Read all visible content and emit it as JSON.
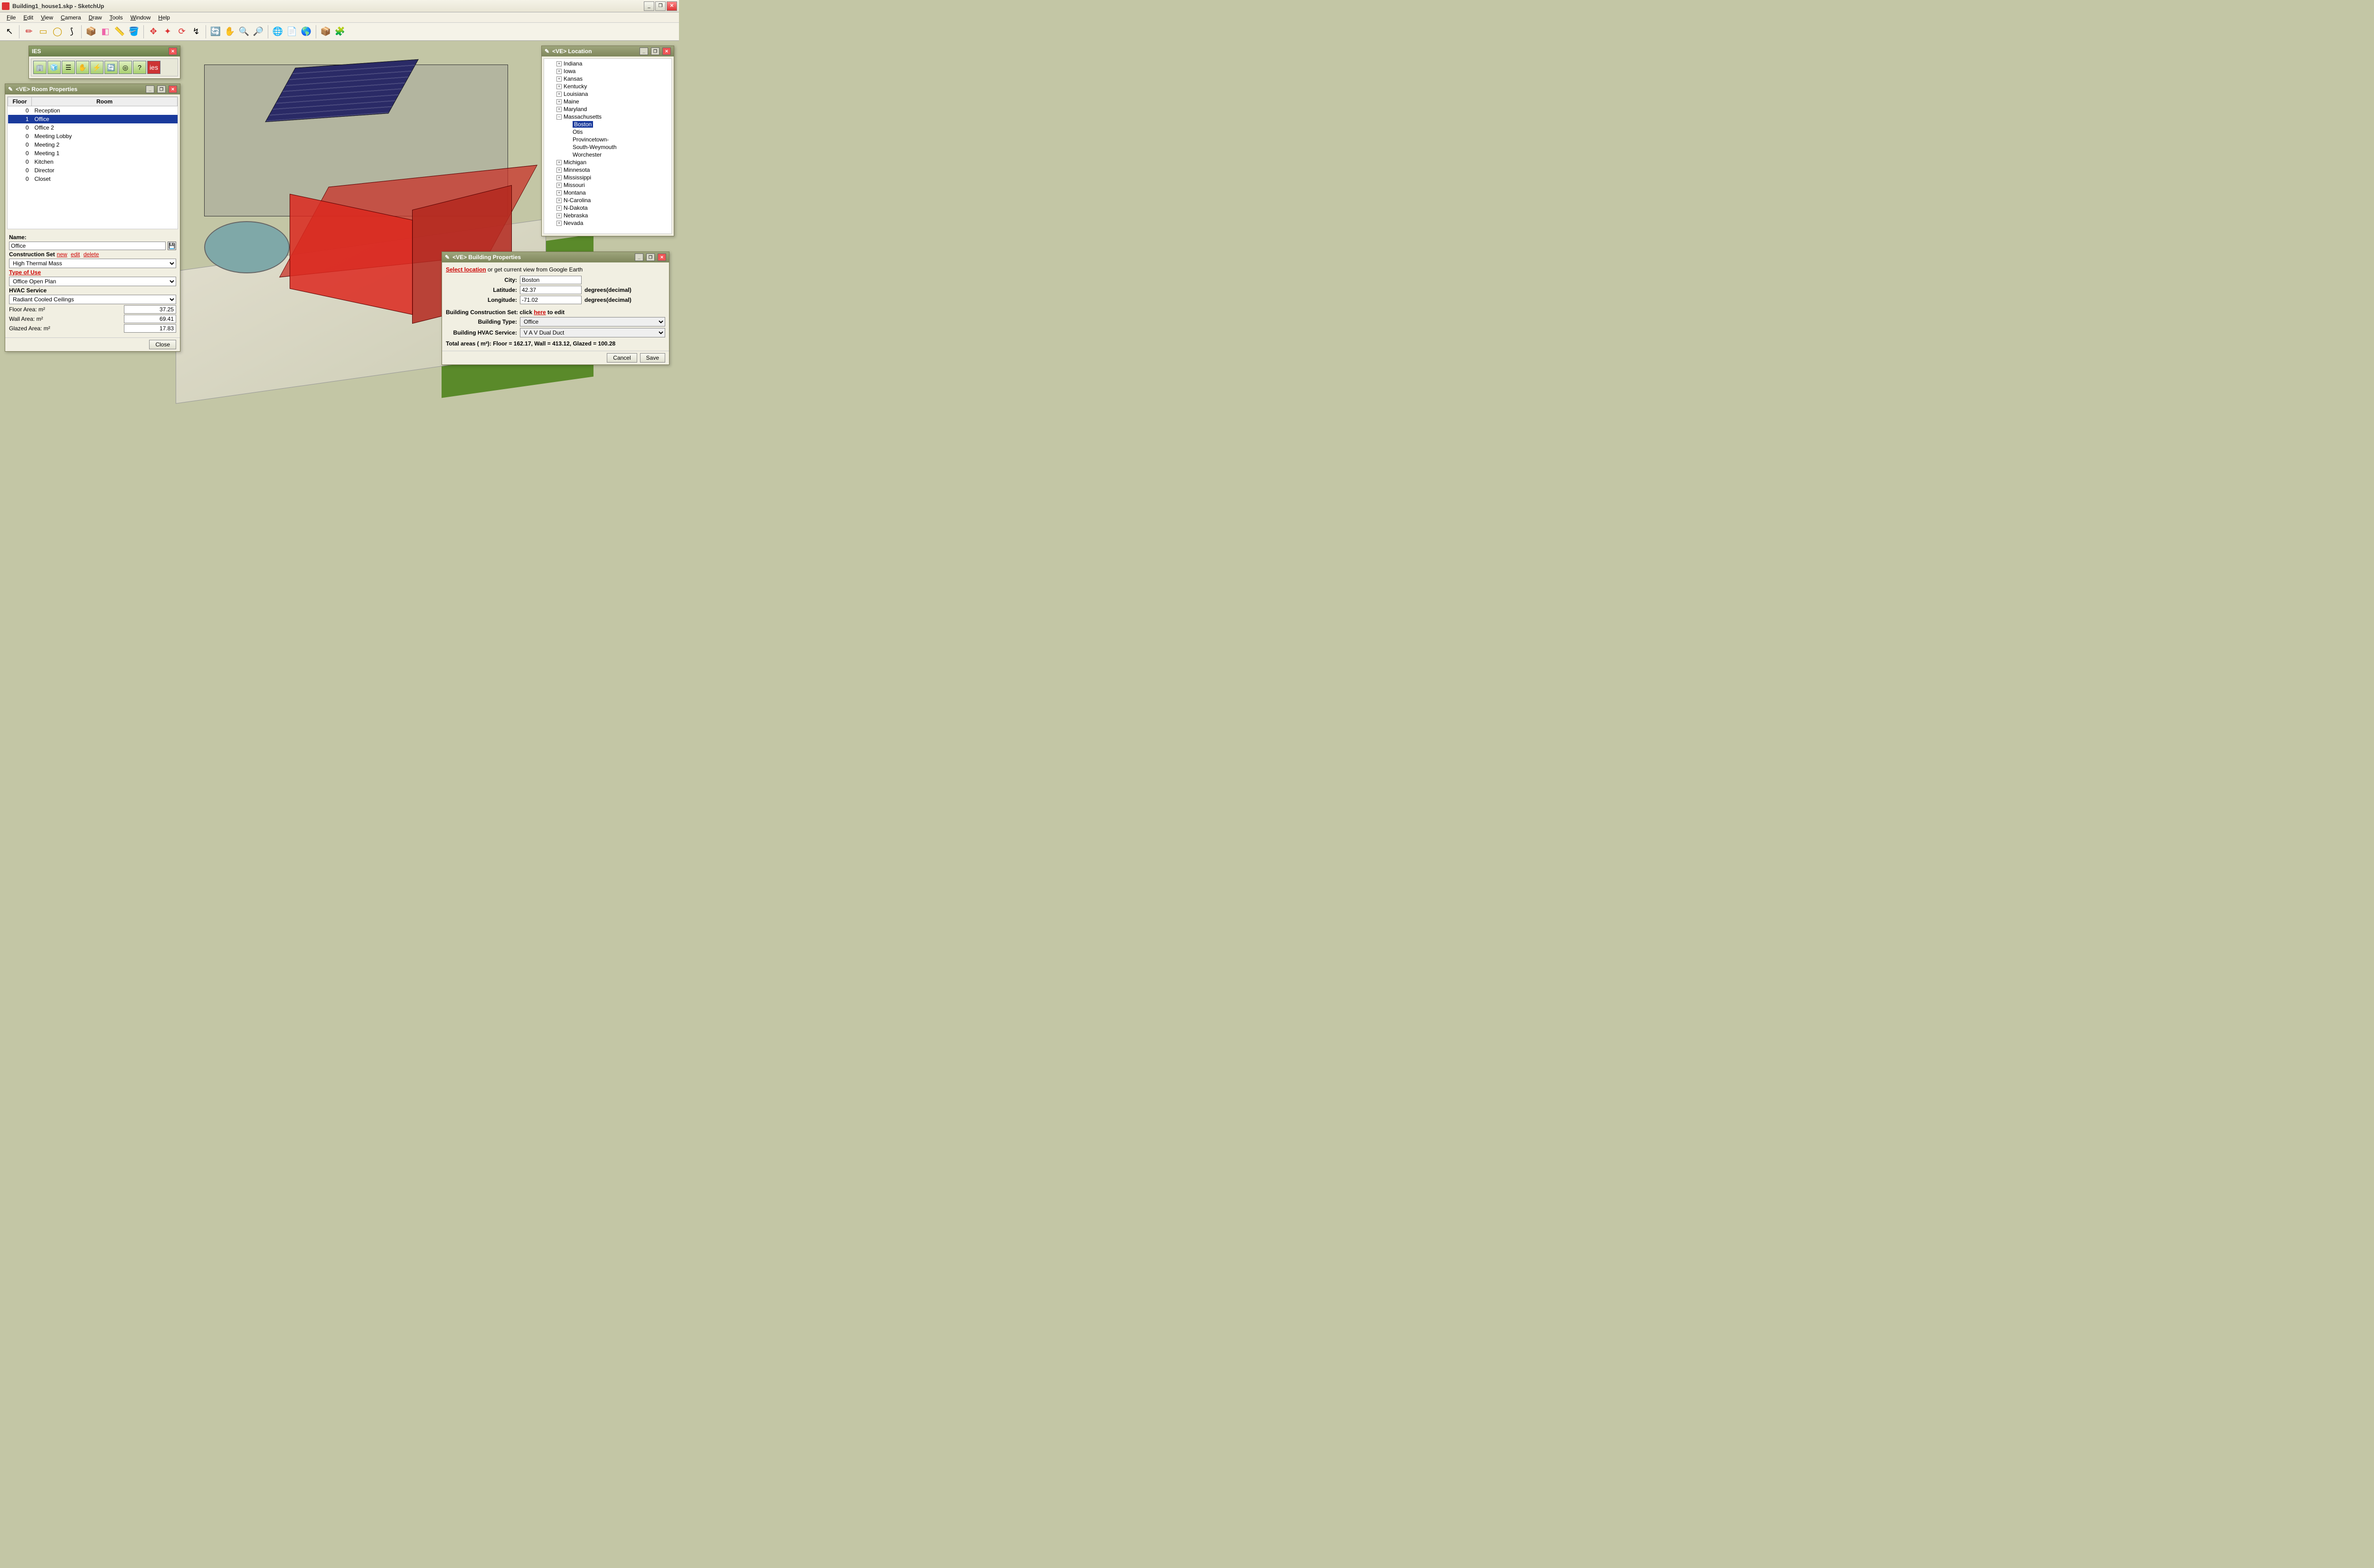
{
  "window": {
    "title": "Building1_house1.skp - SketchUp"
  },
  "menu": [
    "File",
    "Edit",
    "View",
    "Camera",
    "Draw",
    "Tools",
    "Window",
    "Help"
  ],
  "ies_panel": {
    "title": "IES"
  },
  "room_panel": {
    "title": "<VE> Room Properties",
    "cols": [
      "Floor",
      "Room"
    ],
    "rows": [
      {
        "floor": "0",
        "room": "Reception"
      },
      {
        "floor": "1",
        "room": "Office",
        "selected": true
      },
      {
        "floor": "0",
        "room": "Office 2"
      },
      {
        "floor": "0",
        "room": "Meeting Lobby"
      },
      {
        "floor": "0",
        "room": "Meeting 2"
      },
      {
        "floor": "0",
        "room": "Meeting 1"
      },
      {
        "floor": "0",
        "room": "Kitchen"
      },
      {
        "floor": "0",
        "room": "Director"
      },
      {
        "floor": "0",
        "room": "Closet"
      }
    ],
    "name_label": "Name:",
    "name_value": "Office",
    "cons_label": "Construction Set",
    "cons_links": [
      "new",
      "edit",
      "delete"
    ],
    "cons_value": "High Thermal Mass",
    "type_label": "Type of Use",
    "type_value": "Office Open Plan",
    "hvac_label": "HVAC Service",
    "hvac_value": "Radiant Cooled Ceilings",
    "floor_area_label": "Floor Area: m²",
    "floor_area": "37.25",
    "wall_area_label": "Wall Area: m²",
    "wall_area": "69.41",
    "glazed_area_label": "Glazed Area: m²",
    "glazed_area": "17.83",
    "close_btn": "Close"
  },
  "location_panel": {
    "title": "<VE> Location",
    "states_before": [
      "Indiana",
      "Iowa",
      "Kansas",
      "Kentucky",
      "Louisiana",
      "Maine",
      "Maryland"
    ],
    "expanded_state": "Massachusetts",
    "cities": [
      "Boston",
      "Otis",
      "Provincetown-",
      "South-Weymouth",
      "Worchester"
    ],
    "selected_city": "Boston",
    "states_after": [
      "Michigan",
      "Minnesota",
      "Mississippi",
      "Missouri",
      "Montana",
      "N-Carolina",
      "N-Dakota",
      "Nebraska",
      "Nevada"
    ]
  },
  "building_panel": {
    "title": "<VE> Building Properties",
    "select_loc": "Select location",
    "or_text": " or get current view from Google Earth",
    "city_label": "City:",
    "city": "Boston",
    "lat_label": "Latitude:",
    "lat": "42.37",
    "lon_label": "Longitude:",
    "lon": "-71.02",
    "deg_unit": "degrees(decimal)",
    "cons_text_a": "Building Construction Set: click ",
    "cons_here": "here",
    "cons_text_b": " to edit",
    "btype_label": "Building Type:",
    "btype": "Office",
    "bhvac_label": "Building HVAC Service:",
    "bhvac": "V A V Dual Duct",
    "totals": "Total areas ( m²): Floor =  162.17, Wall =  413.12, Glazed =  100.28",
    "cancel": "Cancel",
    "save": "Save"
  }
}
